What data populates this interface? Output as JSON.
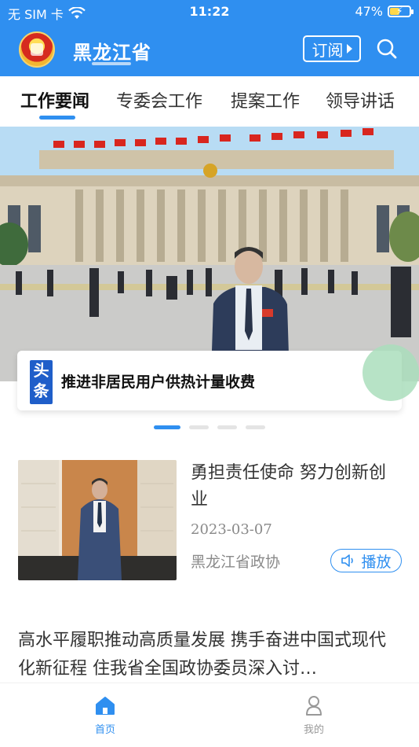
{
  "status_bar": {
    "carrier": "无 SIM 卡",
    "time": "11:22",
    "battery": "47%",
    "battery_level": 0.47
  },
  "nav": {
    "title": "黑龙江省",
    "subscribe_label": "订阅",
    "icons": [
      "emblem-icon",
      "search-icon"
    ]
  },
  "tabs": [
    {
      "label": "工作要闻",
      "active": true
    },
    {
      "label": "专委会工作",
      "active": false
    },
    {
      "label": "提案工作",
      "active": false
    },
    {
      "label": "领导讲话",
      "active": false
    }
  ],
  "banner": {
    "badge": "头条",
    "headline": "推进非居民用户供热计量收费",
    "page_count": 4,
    "active_index": 0
  },
  "articles": [
    {
      "title": "勇担责任使命 努力创新创业",
      "date": "2023-03-07",
      "source": "黑龙江省政协",
      "play_label": "播放"
    },
    {
      "title": "高水平履职推动高质量发展 携手奋进中国式现代化新征程 住我省全国政协委员深入讨…"
    }
  ],
  "tabbar": [
    {
      "label": "首页",
      "icon": "home-icon",
      "active": true
    },
    {
      "label": "我的",
      "icon": "profile-icon",
      "active": false
    }
  ],
  "colors": {
    "brand": "#2f8ff0",
    "headline_badge": "#1f5ec9"
  }
}
